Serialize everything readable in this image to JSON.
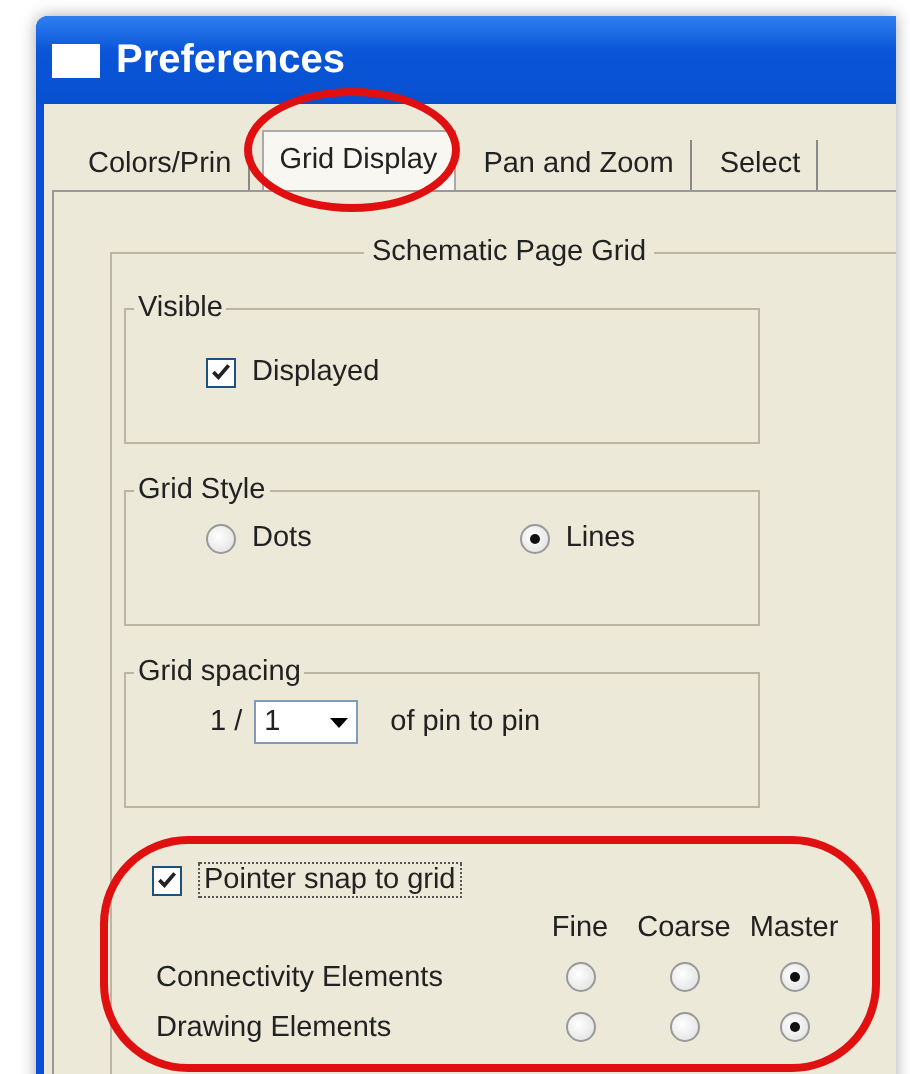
{
  "window": {
    "title": "Preferences"
  },
  "tabs": [
    {
      "label": "Colors/Prin",
      "selected": false
    },
    {
      "label": "Grid Display",
      "selected": true
    },
    {
      "label": "Pan and Zoom",
      "selected": false
    },
    {
      "label": "Select",
      "selected": false
    }
  ],
  "group": {
    "title": "Schematic Page Grid"
  },
  "visible": {
    "title": "Visible",
    "checkbox": {
      "label": "Displayed",
      "checked": true
    }
  },
  "grid_style": {
    "title": "Grid Style",
    "options": [
      {
        "label": "Dots",
        "selected": false
      },
      {
        "label": "Lines",
        "selected": true
      }
    ]
  },
  "grid_spacing": {
    "title": "Grid spacing",
    "prefix": "1 /",
    "value": "1",
    "suffix": "of pin to pin"
  },
  "snap": {
    "checkbox": {
      "label": "Pointer snap to grid",
      "checked": true
    },
    "columns": [
      "Fine",
      "Coarse",
      "Master"
    ],
    "rows": [
      {
        "label": "Connectivity Elements",
        "options": [
          {
            "selected": false
          },
          {
            "selected": false
          },
          {
            "selected": true
          }
        ]
      },
      {
        "label": "Drawing Elements",
        "options": [
          {
            "selected": false
          },
          {
            "selected": false
          },
          {
            "selected": true
          }
        ]
      }
    ]
  }
}
